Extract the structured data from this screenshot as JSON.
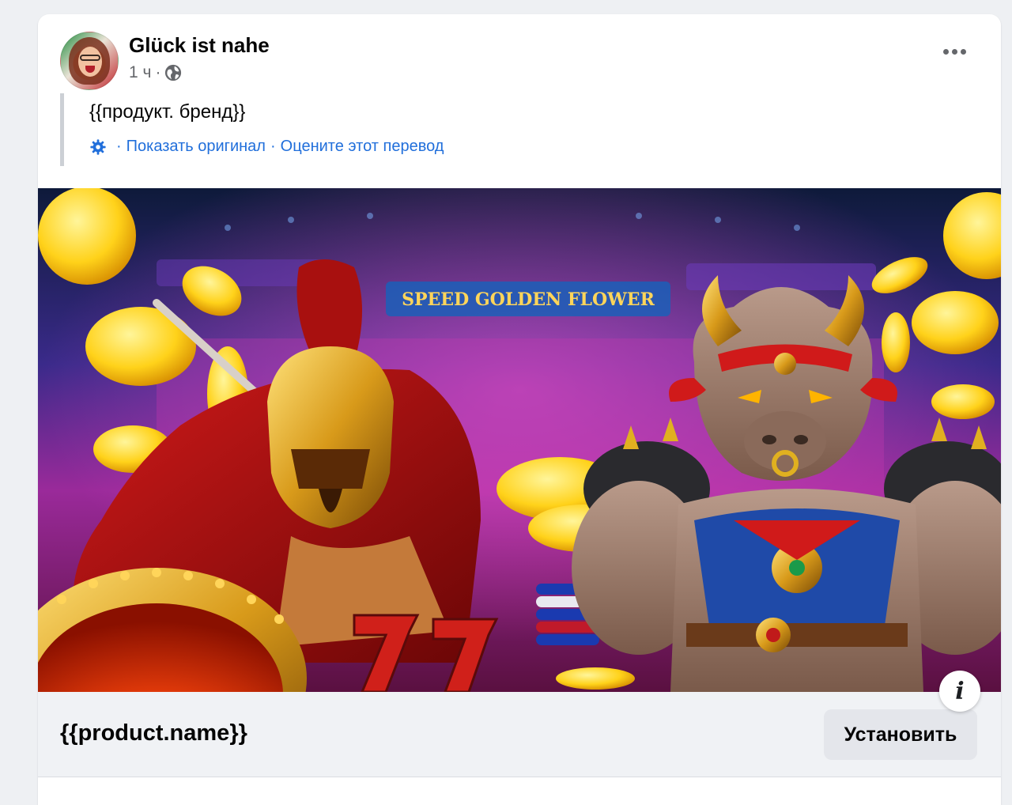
{
  "post": {
    "page_name": "Glück ist nahe",
    "time": "1 ч",
    "separator": "·",
    "text": "{{продукт. бренд}}",
    "translation": {
      "show_original": "Показать оригинал",
      "rate_translation": "Оцените этот перевод",
      "separator": "·"
    }
  },
  "creative": {
    "banner_text": "SPEED GOLDEN FLOWER"
  },
  "info_icon": "i",
  "cta": {
    "product_name": "{{product.name}}",
    "button_label": "Установить"
  },
  "colors": {
    "link": "#216fdb",
    "secondary_text": "#65676b",
    "button_bg": "#e4e6eb",
    "footer_bg": "#f0f2f5"
  },
  "icons": [
    "globe-icon",
    "more-icon",
    "gear-icon",
    "info-icon"
  ]
}
